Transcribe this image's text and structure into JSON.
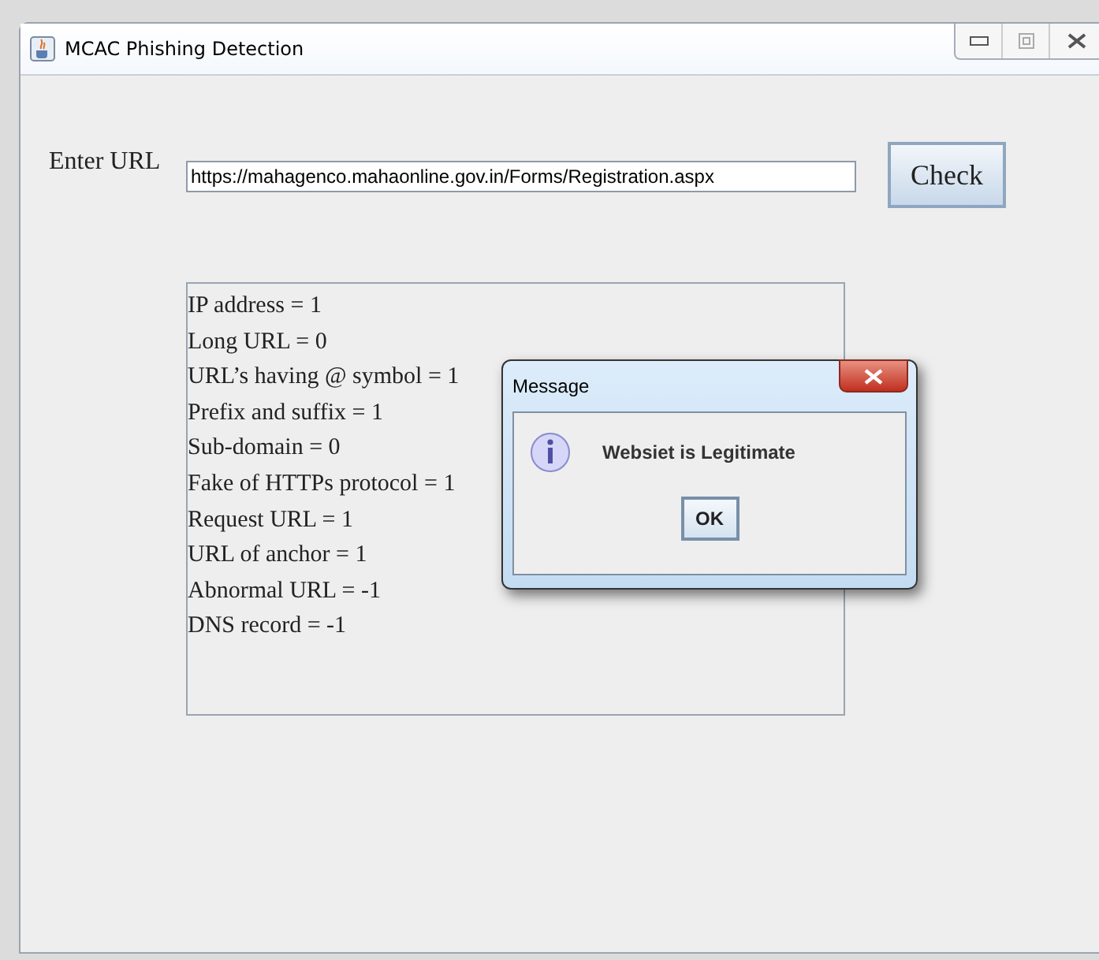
{
  "window": {
    "title": "MCAC Phishing Detection"
  },
  "url_label": "Enter URL",
  "url_field": {
    "value": "https://mahagenco.mahaonline.gov.in/Forms/Registration.aspx"
  },
  "check_button": "Check",
  "results": [
    "IP address = 1",
    "Long URL = 0",
    "URL’s having @ symbol = 1",
    "Prefix and suffix = 1",
    "Sub-domain = 0",
    "Fake of HTTPs protocol = 1",
    "Request URL = 1",
    "URL of anchor = 1",
    "Abnormal URL = -1",
    "DNS record = -1"
  ],
  "dialog": {
    "title": "Message",
    "message": "Websiet is Legitimate",
    "button": "OK"
  }
}
